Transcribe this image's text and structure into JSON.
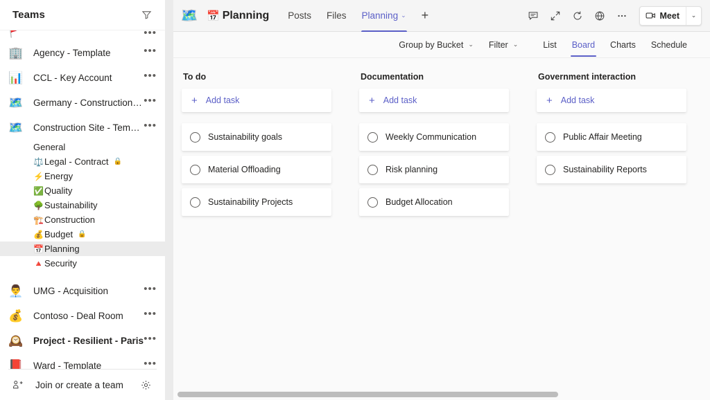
{
  "sidebar": {
    "title": "Teams",
    "filter_icon": "filter-icon",
    "teams": [
      {
        "name": "",
        "emoji": "🚩",
        "clipped": true,
        "bold": false
      },
      {
        "name": "Agency - Template",
        "emoji": "🏢",
        "clipped": false,
        "bold": false
      },
      {
        "name": "CCL - Key Account",
        "emoji": "📊",
        "clipped": false,
        "bold": false
      },
      {
        "name": "Germany - Construction site",
        "emoji": "🗺️",
        "clipped": false,
        "bold": false
      },
      {
        "name": "Construction Site - Template",
        "emoji": "🗺️",
        "clipped": false,
        "bold": false
      }
    ],
    "channels": [
      {
        "emoji": "",
        "name": "General",
        "locked": false,
        "selected": false
      },
      {
        "emoji": "⚖️",
        "name": "Legal - Contract",
        "locked": true,
        "selected": false
      },
      {
        "emoji": "⚡",
        "name": "Energy",
        "locked": false,
        "selected": false
      },
      {
        "emoji": "✅",
        "name": "Quality",
        "locked": false,
        "selected": false
      },
      {
        "emoji": "🌳",
        "name": "Sustainability",
        "locked": false,
        "selected": false
      },
      {
        "emoji": "🏗️",
        "name": "Construction",
        "locked": false,
        "selected": false
      },
      {
        "emoji": "💰",
        "name": "Budget",
        "locked": true,
        "selected": false
      },
      {
        "emoji": "📅",
        "name": "Planning",
        "locked": false,
        "selected": true
      },
      {
        "emoji": "🔺",
        "name": "Security",
        "locked": false,
        "selected": false
      }
    ],
    "teams_after": [
      {
        "name": "UMG - Acquisition",
        "emoji": "👨‍💼",
        "bold": false
      },
      {
        "name": "Contoso - Deal Room",
        "emoji": "💰",
        "bold": false
      },
      {
        "name": "Project - Resilient - Paris",
        "emoji": "🕰️",
        "bold": true
      },
      {
        "name": "Ward - Template",
        "emoji": "📕",
        "bold": false
      }
    ],
    "more_glyph": "•••",
    "footer": {
      "join_label": "Join or create a team",
      "join_icon": "add-team-icon",
      "settings_icon": "gear-icon"
    }
  },
  "header": {
    "team_avatar_emoji": "🗺️",
    "title_emoji": "📅",
    "title": "Planning",
    "tabs": [
      {
        "label": "Posts",
        "active": false,
        "has_chevron": false
      },
      {
        "label": "Files",
        "active": false,
        "has_chevron": false
      },
      {
        "label": "Planning",
        "active": true,
        "has_chevron": true
      }
    ],
    "add_tab_label": "+",
    "chevron_glyph": "⌄",
    "actions": [
      {
        "icon": "chat-icon"
      },
      {
        "icon": "expand-icon"
      },
      {
        "icon": "refresh-icon"
      },
      {
        "icon": "globe-icon"
      },
      {
        "icon": "more-options-icon"
      }
    ],
    "meet": {
      "label": "Meet",
      "icon": "camera-icon",
      "caret_glyph": "⌄"
    }
  },
  "planner": {
    "toolbar": {
      "group_by_label": "Group by Bucket",
      "filter_label": "Filter",
      "chevron_glyph": "⌄"
    },
    "view_tabs": [
      {
        "label": "List",
        "active": false
      },
      {
        "label": "Board",
        "active": true
      },
      {
        "label": "Charts",
        "active": false
      },
      {
        "label": "Schedule",
        "active": false
      }
    ],
    "add_task_label": "Add task",
    "plus_glyph": "+",
    "buckets": [
      {
        "title": "To do",
        "tasks": [
          {
            "label": "Sustainability goals",
            "done": false
          },
          {
            "label": "Material Offloading",
            "done": false
          },
          {
            "label": "Sustainability Projects",
            "done": false
          }
        ]
      },
      {
        "title": "Documentation",
        "tasks": [
          {
            "label": "Weekly Communication",
            "done": false
          },
          {
            "label": "Risk planning",
            "done": false
          },
          {
            "label": "Budget Allocation",
            "done": false
          }
        ]
      },
      {
        "title": "Government interaction",
        "tasks": [
          {
            "label": "Public Affair Meeting",
            "done": false
          },
          {
            "label": "Sustainability Reports",
            "done": false
          }
        ]
      }
    ]
  },
  "colors": {
    "accent": "#5b5fc7",
    "sidebar_bg": "#ffffff",
    "main_bg": "#fafafa",
    "selected_channel": "#ebebeb",
    "card_bg": "#ffffff",
    "text": "#252423"
  }
}
